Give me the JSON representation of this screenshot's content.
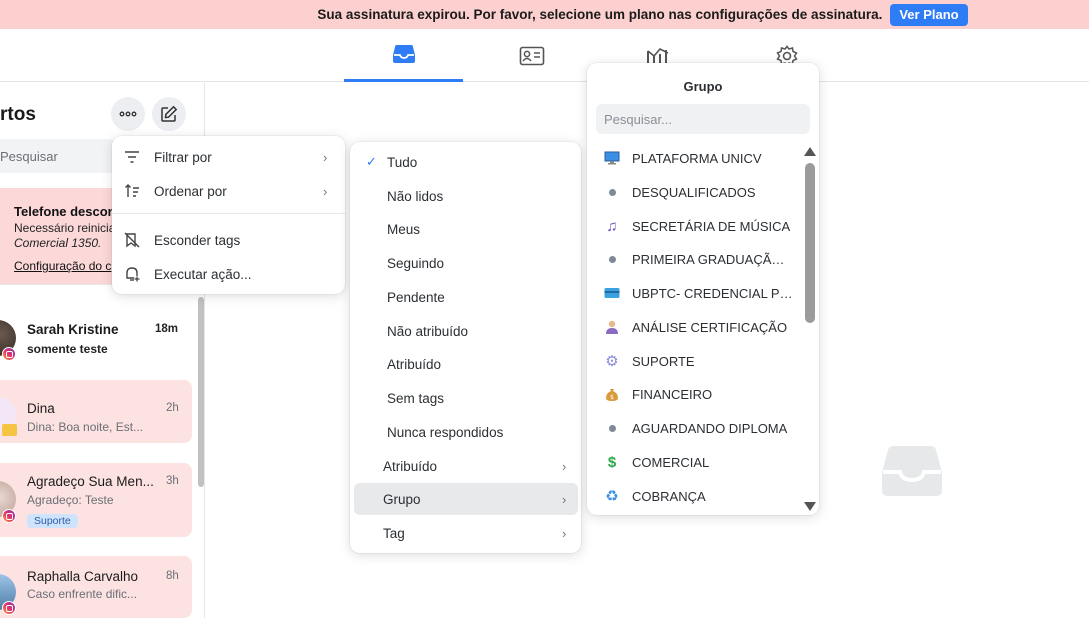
{
  "banner": {
    "message": "Sua assinatura expirou. Por favor, selecione um plano nas configurações de assinatura.",
    "button_label": "Ver Plano",
    "background": "#fcd0cf",
    "button_color": "#2f7df6"
  },
  "topnav": {
    "tabs": [
      {
        "icon": "inbox-icon",
        "active": true
      },
      {
        "icon": "contact-card-icon",
        "active": false
      },
      {
        "icon": "reports-chart-icon",
        "active": false
      },
      {
        "icon": "settings-gear-icon",
        "active": false
      }
    ],
    "accent": "#2f7df6"
  },
  "sidebar": {
    "title": "rtos",
    "search_placeholder": "Pesquisar",
    "alert": {
      "title": "Telefone descon",
      "line1": "Necessário reinicia",
      "line2": "Comercial 1350.",
      "link": "Configuração do c"
    },
    "conversations": [
      {
        "name": "Sarah Kristine",
        "time": "18m",
        "preview": "somente teste",
        "unread": true,
        "channel": "instagram"
      },
      {
        "name": "Dina",
        "time": "2h",
        "preview": "Dina: Boa noite, Est...",
        "unread": false,
        "channel": "email"
      },
      {
        "name": "Agradeço Sua Men...",
        "time": "3h",
        "preview": "Agradeço: Teste",
        "tag": "Suporte",
        "unread": false,
        "channel": "instagram"
      },
      {
        "name": "Raphalla Carvalho",
        "time": "8h",
        "preview": "Caso enfrente dific...",
        "unread": false,
        "channel": "instagram"
      }
    ]
  },
  "menu_options": {
    "items": [
      {
        "label": "Filtrar por",
        "icon": "filter-icon",
        "submenu": true
      },
      {
        "label": "Ordenar por",
        "icon": "sort-icon",
        "submenu": true
      },
      {
        "label": "Esconder tags",
        "icon": "hide-tags-icon",
        "submenu": false
      },
      {
        "label": "Executar ação...",
        "icon": "run-action-icon",
        "submenu": false
      }
    ]
  },
  "menu_filter": {
    "items": [
      {
        "label": "Tudo",
        "checked": true
      },
      {
        "label": "Não lidos"
      },
      {
        "label": "Meus"
      },
      {
        "label": "Seguindo"
      },
      {
        "label": "Pendente"
      },
      {
        "label": "Não atribuído"
      },
      {
        "label": "Atribuído"
      },
      {
        "label": "Sem tags"
      },
      {
        "label": "Nunca respondidos"
      },
      {
        "label": "Atribuído",
        "submenu": true
      },
      {
        "label": "Grupo",
        "submenu": true,
        "active": true
      },
      {
        "label": "Tag",
        "submenu": true
      }
    ]
  },
  "menu_group": {
    "title": "Grupo",
    "search_placeholder": "Pesquisar...",
    "items": [
      {
        "label": "PLATAFORMA UNICV",
        "icon": "computer-icon"
      },
      {
        "label": "DESQUALIFICADOS",
        "icon": "dot-icon"
      },
      {
        "label": "SECRETÁRIA DE MÚSICA",
        "icon": "music-note-icon"
      },
      {
        "label": "PRIMEIRA GRADUAÇÃO UNICV",
        "icon": "dot-icon"
      },
      {
        "label": "UBPTC- CREDENCIAL PSICANALISTA",
        "icon": "id-card-icon"
      },
      {
        "label": "ANÁLISE CERTIFICAÇÃO",
        "icon": "person-icon"
      },
      {
        "label": "SUPORTE",
        "icon": "gear-icon"
      },
      {
        "label": "FINANCEIRO",
        "icon": "money-bag-icon"
      },
      {
        "label": "AGUARDANDO DIPLOMA",
        "icon": "dot-icon"
      },
      {
        "label": "COMERCIAL",
        "icon": "dollar-icon"
      },
      {
        "label": "COBRANÇA",
        "icon": "recycle-icon"
      }
    ]
  }
}
